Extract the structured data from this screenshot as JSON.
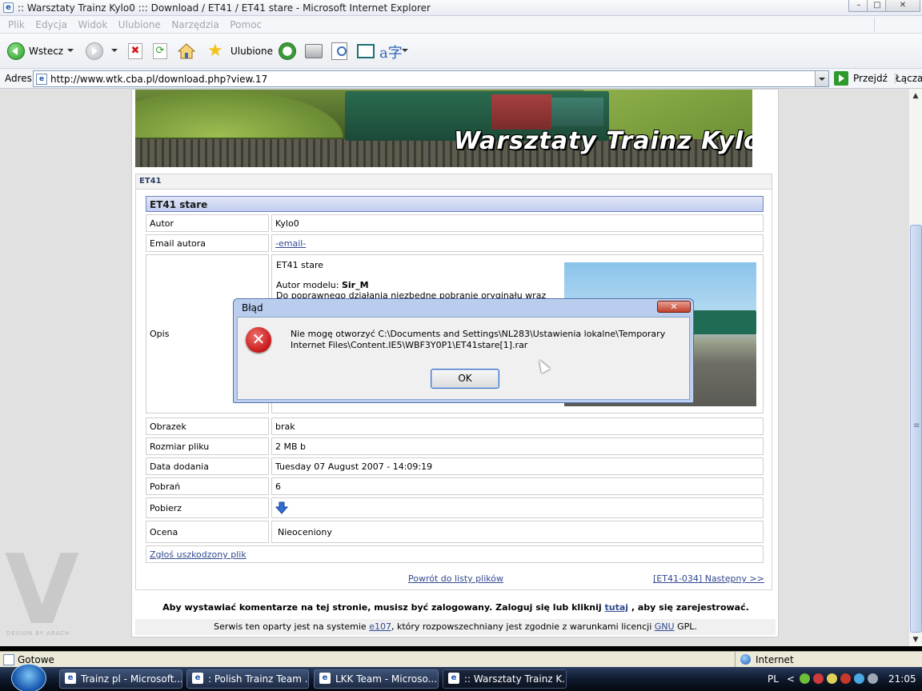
{
  "window": {
    "title": ":: Warsztaty Trainz Kylo0 ::: Download / ET41 / ET41 stare - Microsoft Internet Explorer",
    "ie_icon": "e",
    "min": "–",
    "max": "□",
    "close": "✕"
  },
  "menu": [
    "Plik",
    "Edycja",
    "Widok",
    "Ulubione",
    "Narzędzia",
    "Pomoc"
  ],
  "toolbar": {
    "back_label": "Wstecz",
    "favorites_label": "Ulubione",
    "stop_glyph": "✖",
    "refresh_glyph": "⟳",
    "star_glyph": "★",
    "translate_glyph": "a字"
  },
  "address": {
    "label": "Adres",
    "url": "http://www.wtk.cba.pl/download.php?view.17",
    "go_label": "Przejdź",
    "links_label": "Łącza"
  },
  "page": {
    "banner_title": "Warsztaty Trainz Kylo0",
    "category": "ET41",
    "item_title": "ET41 stare",
    "rows": {
      "autor": {
        "label": "Autor",
        "value": "Kylo0"
      },
      "email": {
        "label": "Email autora",
        "value": "-email-"
      },
      "opis_label": "Opis",
      "opis_line1": "ET41 stare",
      "opis_line2a": "Autor modelu: ",
      "opis_line2b": "Sir_M",
      "opis_line3": "Do poprawnego działania niezbędne pobranie oryginału wraz",
      "obrazek": {
        "label": "Obrazek",
        "value": "brak"
      },
      "rozmiar": {
        "label": "Rozmiar pliku",
        "value": "2 MB b"
      },
      "data": {
        "label": "Data dodania",
        "value": "Tuesday 07 August 2007 - 14:09:19"
      },
      "pobran": {
        "label": "Pobrań",
        "value": "6"
      },
      "pobierz": {
        "label": "Pobierz"
      },
      "ocena": {
        "label": "Ocena",
        "value": "Nieoceniony"
      }
    },
    "report_link": "Zgłoś uszkodzony plik",
    "back_link": "Powrót do listy plików",
    "next_link": "[ET41-034] Następny >>",
    "comment_note_a": "Aby wystawiać komentarze na tej stronie, musisz być zalogowany. Zaloguj się lub kliknij ",
    "comment_note_link": "tutaj",
    "comment_note_b": " , aby się zarejestrować.",
    "footer_a": "Serwis ten oparty jest na systemie ",
    "footer_link1": "e107",
    "footer_b": ", który rozpowszechniany jest zgodnie z warunkami licencji ",
    "footer_link2": "GNU",
    "footer_c": " GPL.",
    "watermark": "V",
    "watermark_sub": "DESIGN BY ARACH"
  },
  "dialog": {
    "title": "Błąd",
    "close_glyph": "✕",
    "error_glyph": "✕",
    "message": "Nie mogę otworzyć C:\\Documents and Settings\\NL283\\Ustawienia lokalne\\Temporary Internet Files\\Content.IE5\\WBF3Y0P1\\ET41stare[1].rar",
    "ok_label": "OK"
  },
  "status": {
    "text": "Gotowe",
    "zone": "Internet"
  },
  "taskbar": {
    "tasks": [
      "Trainz pl - Microsoft...",
      ": Polish Trainz Team ...",
      "LKK Team - Microso...",
      ":: Warsztaty Trainz K..."
    ],
    "lang": "PL",
    "arrow": "<",
    "clock": "21:05"
  },
  "colors": {
    "link": "#32498f",
    "dialog_frame": "#b9cdef",
    "header_gradient_end": "#c1cdf1"
  }
}
